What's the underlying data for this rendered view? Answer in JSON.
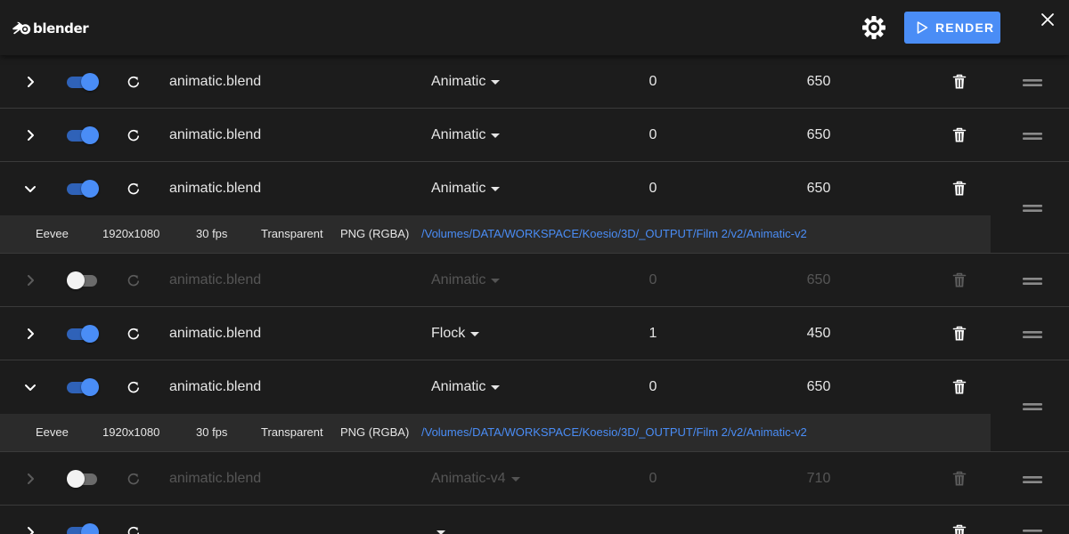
{
  "app": {
    "logo_text": "blender",
    "render_label": "RENDER"
  },
  "colors": {
    "accent": "#4a8df6",
    "background": "#1c1c1c",
    "detail_background": "#2b2b2b",
    "toggle_off_track": "#6b6b6b"
  },
  "icons": {
    "logo": "blender-logo-icon",
    "settings": "gear-icon",
    "render": "play-icon",
    "close": "close-icon",
    "expand": "chevron-right-icon",
    "collapse": "chevron-down-icon",
    "reload": "refresh-icon",
    "delete": "trash-icon",
    "reorder": "drag-handle-icon",
    "preset_menu": "caret-down-icon"
  },
  "jobs": [
    {
      "expanded": false,
      "enabled": true,
      "file": "animatic.blend",
      "preset": "Animatic",
      "start": "0",
      "end": "650"
    },
    {
      "expanded": false,
      "enabled": true,
      "file": "animatic.blend",
      "preset": "Animatic",
      "start": "0",
      "end": "650"
    },
    {
      "expanded": true,
      "enabled": true,
      "file": "animatic.blend",
      "preset": "Animatic",
      "start": "0",
      "end": "650",
      "details": {
        "engine": "Eevee",
        "resolution": "1920x1080",
        "fps": "30 fps",
        "alpha": "Transparent",
        "format": "PNG (RGBA)",
        "output_path": "/Volumes/DATA/WORKSPACE/Koesio/3D/_OUTPUT/Film 2/v2/Animatic-v2"
      }
    },
    {
      "expanded": false,
      "enabled": false,
      "file": "animatic.blend",
      "preset": "Animatic",
      "start": "0",
      "end": "650"
    },
    {
      "expanded": false,
      "enabled": true,
      "file": "animatic.blend",
      "preset": "Flock",
      "start": "1",
      "end": "450"
    },
    {
      "expanded": true,
      "enabled": true,
      "file": "animatic.blend",
      "preset": "Animatic",
      "start": "0",
      "end": "650",
      "details": {
        "engine": "Eevee",
        "resolution": "1920x1080",
        "fps": "30 fps",
        "alpha": "Transparent",
        "format": "PNG (RGBA)",
        "output_path": "/Volumes/DATA/WORKSPACE/Koesio/3D/_OUTPUT/Film 2/v2/Animatic-v2"
      }
    },
    {
      "expanded": false,
      "enabled": false,
      "file": "animatic.blend",
      "preset": "Animatic-v4",
      "start": "0",
      "end": "710"
    },
    {
      "expanded": false,
      "enabled": true,
      "file": "",
      "preset": "",
      "start": "",
      "end": ""
    }
  ]
}
